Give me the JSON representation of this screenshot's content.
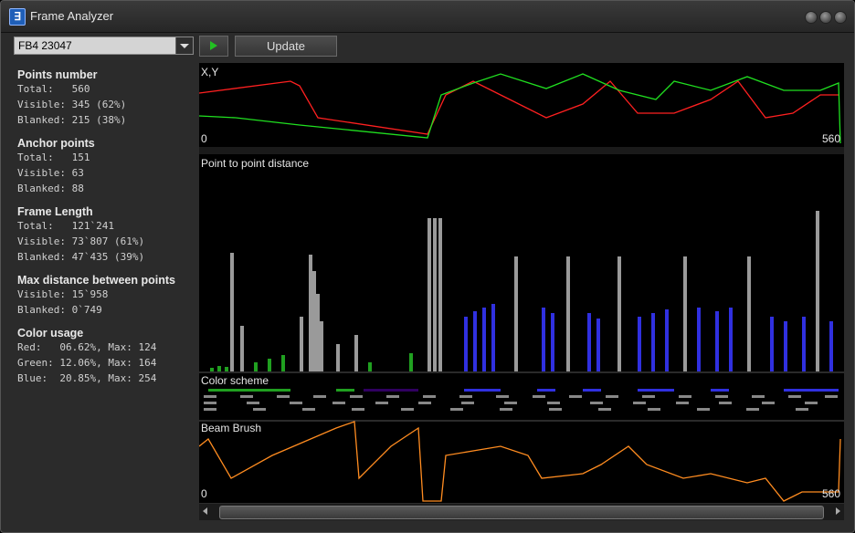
{
  "window": {
    "title": "Frame Analyzer",
    "icon": "app-logo-icon"
  },
  "toolbar": {
    "frame_value": "FB4 23047",
    "update_label": "Update",
    "play_icon": "play-icon"
  },
  "stats": {
    "points": {
      "heading": "Points number",
      "total": "Total:   560",
      "visible": "Visible: 345 (62%)",
      "blanked": "Blanked: 215 (38%)"
    },
    "anchor": {
      "heading": "Anchor points",
      "total": "Total:   151",
      "visible": "Visible: 63",
      "blanked": "Blanked: 88"
    },
    "length": {
      "heading": "Frame Length",
      "total": "Total:   121`241",
      "visible": "Visible: 73`807 (61%)",
      "blanked": "Blanked: 47`435 (39%)"
    },
    "maxdist": {
      "heading": "Max distance between points",
      "visible": "Visible: 15`958",
      "blanked": "Blanked: 0`749"
    },
    "color": {
      "heading": "Color usage",
      "red": "Red:   06.62%, Max: 124",
      "green": "Green: 12.06%, Max: 164",
      "blue": "Blue:  20.85%, Max: 254"
    }
  },
  "plots": {
    "xy": {
      "label": "X,Y",
      "min": "0",
      "max": "560"
    },
    "distance": {
      "label": "Point to point distance"
    },
    "scheme": {
      "label": "Color scheme"
    },
    "brush": {
      "label": "Beam Brush",
      "min": "0",
      "max": "560"
    }
  },
  "colors": {
    "x_line": "#ff2020",
    "y_line": "#20e020",
    "brush_line": "#ff8c20",
    "bar_gray": "#9a9a9a",
    "bar_blue": "#3030e0",
    "bar_green": "#20a020"
  }
}
